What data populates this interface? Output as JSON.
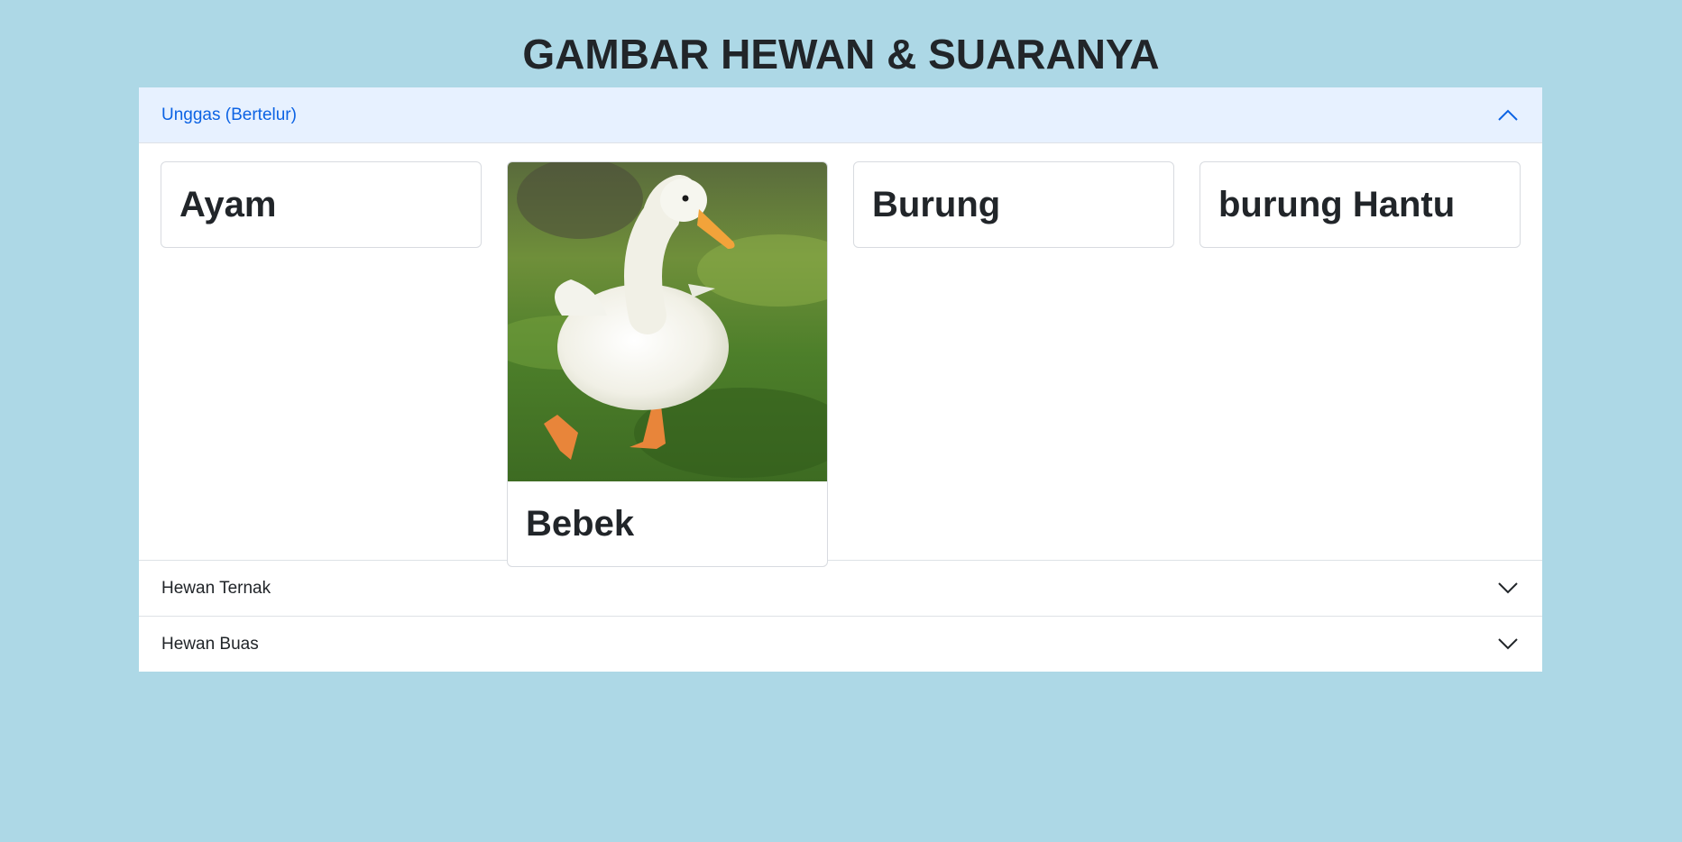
{
  "page": {
    "title": "GAMBAR HEWAN & SUARANYA"
  },
  "accordion": {
    "sections": [
      {
        "label": "Unggas (Bertelur)",
        "expanded": true,
        "cards": [
          {
            "title": "Ayam",
            "has_image": false
          },
          {
            "title": "Bebek",
            "has_image": true,
            "image": "white-duck-walking-on-grass"
          },
          {
            "title": "Burung",
            "has_image": false
          },
          {
            "title": "burung Hantu",
            "has_image": false
          }
        ]
      },
      {
        "label": "Hewan Ternak",
        "expanded": false
      },
      {
        "label": "Hewan Buas",
        "expanded": false
      }
    ]
  },
  "colors": {
    "background": "#add8e6",
    "open_header_bg": "#e7f1ff",
    "open_header_text": "#0c63e4"
  },
  "icons": {
    "expanded": "chevron-up-icon",
    "collapsed": "chevron-down-icon"
  }
}
